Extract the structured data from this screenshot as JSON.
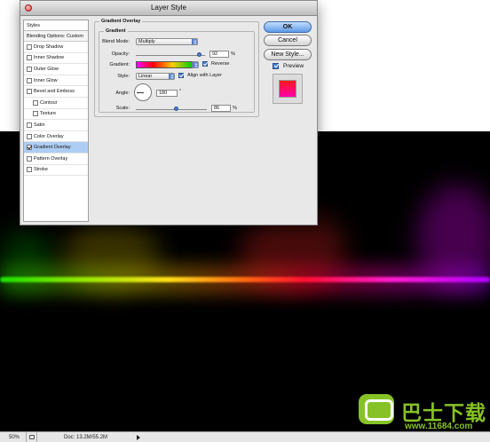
{
  "dialog": {
    "title": "Layer Style",
    "styles_header": "Styles",
    "blending_options": "Blending Options: Custom",
    "style_items": [
      {
        "label": "Drop Shadow",
        "checked": false,
        "sub": false,
        "selected": false
      },
      {
        "label": "Inner Shadow",
        "checked": false,
        "sub": false,
        "selected": false
      },
      {
        "label": "Outer Glow",
        "checked": false,
        "sub": false,
        "selected": false
      },
      {
        "label": "Inner Glow",
        "checked": false,
        "sub": false,
        "selected": false
      },
      {
        "label": "Bevel and Emboss",
        "checked": false,
        "sub": false,
        "selected": false
      },
      {
        "label": "Contour",
        "checked": false,
        "sub": true,
        "selected": false
      },
      {
        "label": "Texture",
        "checked": false,
        "sub": true,
        "selected": false
      },
      {
        "label": "Satin",
        "checked": false,
        "sub": false,
        "selected": false
      },
      {
        "label": "Color Overlay",
        "checked": false,
        "sub": false,
        "selected": false
      },
      {
        "label": "Gradient Overlay",
        "checked": true,
        "sub": false,
        "selected": true
      },
      {
        "label": "Pattern Overlay",
        "checked": false,
        "sub": false,
        "selected": false
      },
      {
        "label": "Stroke",
        "checked": false,
        "sub": false,
        "selected": false
      }
    ],
    "gradient_overlay": {
      "section_title": "Gradient Overlay",
      "group_title": "Gradient",
      "blend_mode_label": "Blend Mode:",
      "blend_mode_value": "Multiply",
      "opacity_label": "Opacity:",
      "opacity_value": "92",
      "opacity_unit": "%",
      "opacity_fraction": 0.92,
      "gradient_label": "Gradient:",
      "reverse_label": "Reverse",
      "reverse_checked": true,
      "style_label": "Style:",
      "style_value": "Linear",
      "align_label": "Align with Layer",
      "align_checked": true,
      "angle_label": "Angle:",
      "angle_value": "180",
      "angle_unit": "°",
      "scale_label": "Scale:",
      "scale_value": "86",
      "scale_unit": "%",
      "scale_fraction": 0.57
    },
    "buttons": {
      "ok": "OK",
      "cancel": "Cancel",
      "new_style": "New Style..."
    },
    "preview_label": "Preview",
    "preview_checked": true
  },
  "statusbar": {
    "zoom": "50%",
    "doc_info": "Doc: 13.2M/55.2M"
  },
  "watermark": {
    "cn_text": "巴士下载",
    "url": "www.11684.com"
  }
}
